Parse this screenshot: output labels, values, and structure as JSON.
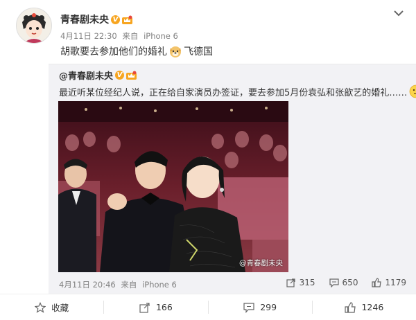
{
  "post": {
    "author": "青春剧未央",
    "verified_badge": "V",
    "time": "4月11日 22:30",
    "source_prefix": "来自",
    "source": "iPhone 6",
    "text_before": "胡歌要去参加他们的婚礼",
    "text_after": "飞德国"
  },
  "repost": {
    "author": "@青春剧未央",
    "text": "最近听某位经纪人说，正在给自家演员办签证，要去参加5月份袁弘和张歆艺的婚礼……",
    "photo_watermark": "@青春剧未央",
    "time": "4月11日 20:46",
    "source_prefix": "来自",
    "source": "iPhone 6",
    "reposts": "315",
    "comments": "650",
    "likes": "1179"
  },
  "footer": {
    "favorite_label": "收藏",
    "repost_count": "166",
    "comment_count": "299",
    "like_count": "1246"
  },
  "colors": {
    "accent_orange": "#f7a520",
    "meta_gray": "#808080",
    "repost_bg": "#f2f2f5"
  },
  "icons": [
    "avatar",
    "verified-v-icon",
    "vip-crown-icon",
    "doge-emoji-icon",
    "smile-emoji-icon",
    "chevron-down-icon",
    "star-icon",
    "repost-icon",
    "comment-icon",
    "like-icon"
  ]
}
